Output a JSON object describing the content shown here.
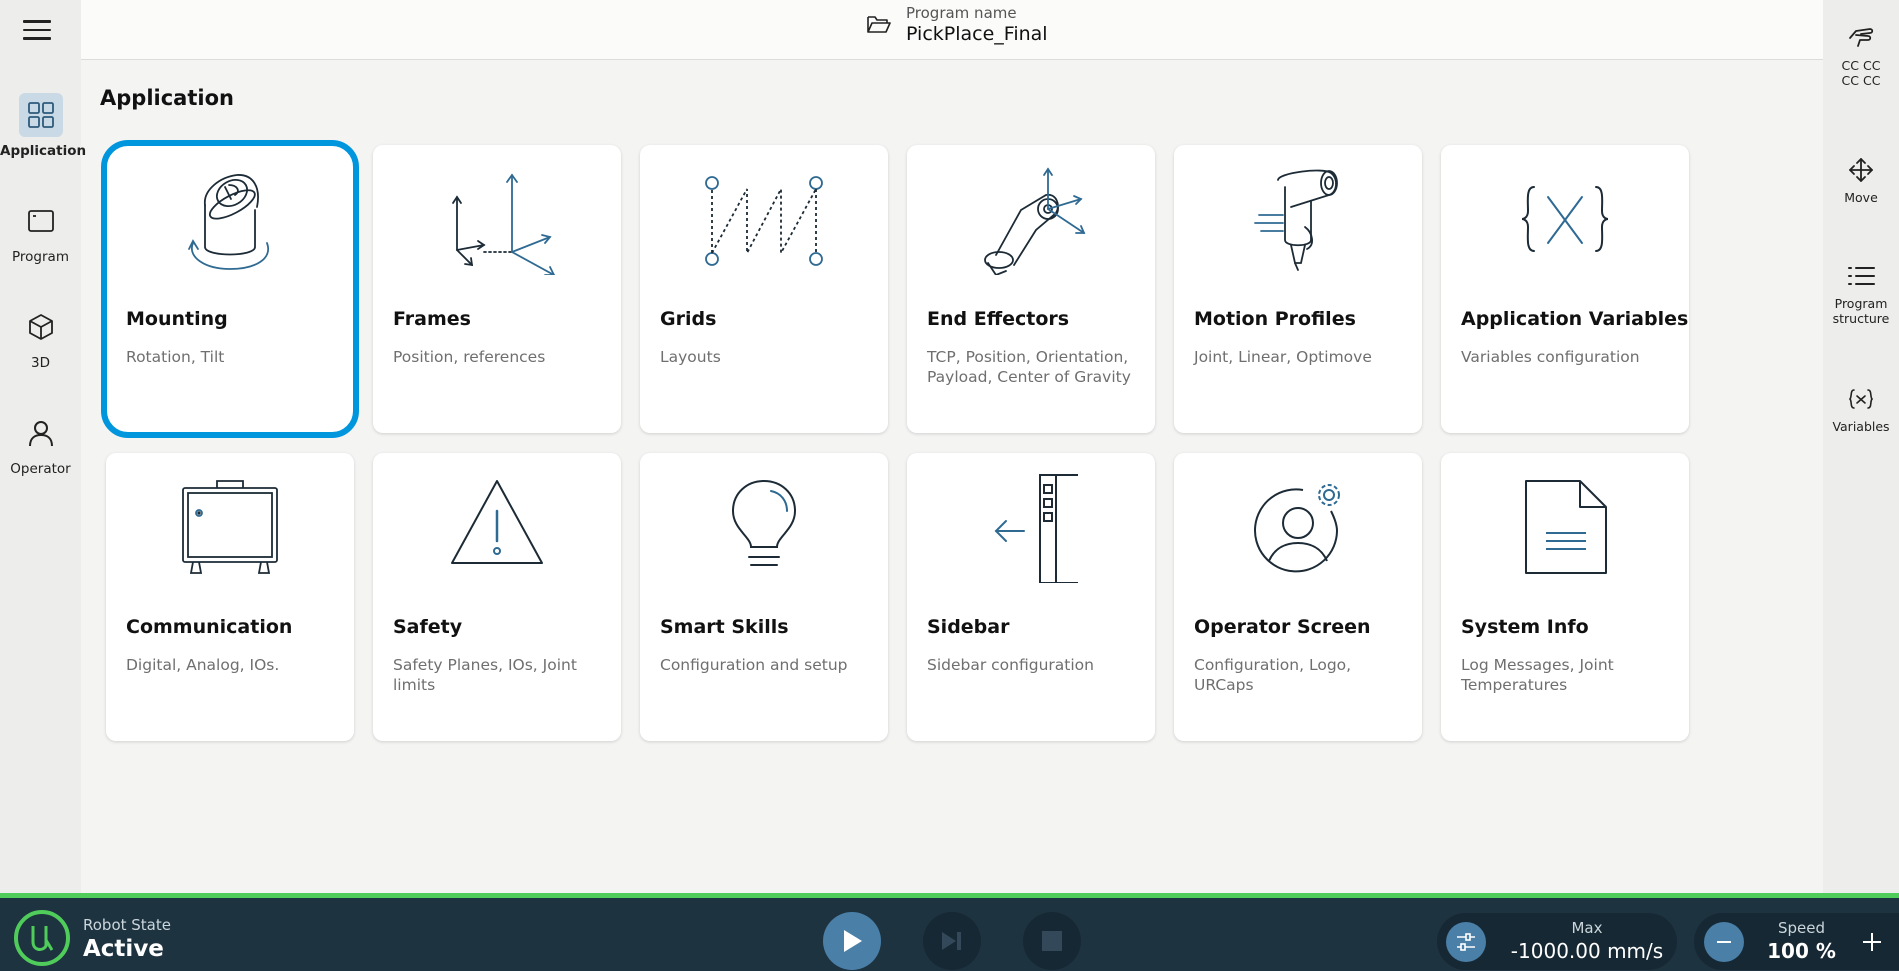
{
  "header": {
    "program_label": "Program name",
    "program_name": "PickPlace_Final"
  },
  "page_title": "Application",
  "left_nav": [
    {
      "label": "Application",
      "icon": "grid-icon"
    },
    {
      "label": "Program",
      "icon": "window-icon"
    },
    {
      "label": "3D",
      "icon": "cube-icon"
    },
    {
      "label": "Operator",
      "icon": "person-icon"
    }
  ],
  "right_nav": [
    {
      "label": "CC CC\nCC CC",
      "icon": "hand-icon"
    },
    {
      "label": "Move",
      "icon": "move-arrows-icon"
    },
    {
      "label": "Program\nstructure",
      "icon": "list-icon"
    },
    {
      "label": "Variables",
      "icon": "variable-x-icon"
    }
  ],
  "cards": [
    {
      "title": "Mounting",
      "subtitle": "Rotation, Tilt",
      "icon": "robot-base-icon",
      "selected": true
    },
    {
      "title": "Frames",
      "subtitle": "Position, references",
      "icon": "frames-axes-icon"
    },
    {
      "title": "Grids",
      "subtitle": "Layouts",
      "icon": "grid-zigzag-icon"
    },
    {
      "title": "End Effectors",
      "subtitle": "TCP, Position, Orientation, Payload, Center of Gravity",
      "icon": "end-effector-icon"
    },
    {
      "title": "Motion Profiles",
      "subtitle": "Joint, Linear, Optimove",
      "icon": "motion-profile-icon"
    },
    {
      "title": "Application Variables",
      "subtitle": "Variables configuration",
      "icon": "braces-x-icon"
    },
    {
      "title": "Communication",
      "subtitle": "Digital, Analog, IOs.",
      "icon": "control-box-icon"
    },
    {
      "title": "Safety",
      "subtitle": "Safety Planes, IOs, Joint limits",
      "icon": "warning-triangle-icon"
    },
    {
      "title": "Smart Skills",
      "subtitle": "Configuration and setup",
      "icon": "lightbulb-icon"
    },
    {
      "title": "Sidebar",
      "subtitle": "Sidebar configuration",
      "icon": "sidebar-panel-icon"
    },
    {
      "title": "Operator Screen",
      "subtitle": "Configuration, Logo, URCaps",
      "icon": "operator-gear-icon"
    },
    {
      "title": "System Info",
      "subtitle": "Log Messages, Joint Temperatures",
      "icon": "document-icon"
    }
  ],
  "bottom": {
    "robot_state_label": "Robot State",
    "robot_state_value": "Active",
    "max_label": "Max",
    "max_value": "-1000.00 mm/s",
    "speed_label": "Speed",
    "speed_value": "100 %",
    "status_color": "#4fcc5a",
    "accent_color": "#0096de"
  }
}
